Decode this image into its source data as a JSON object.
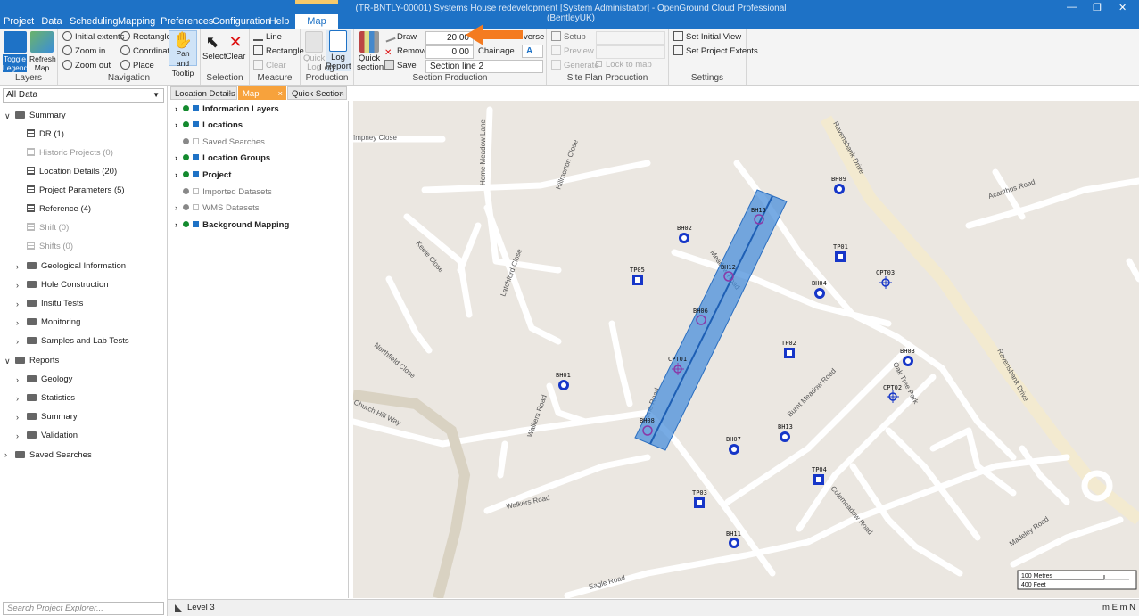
{
  "window": {
    "title": "(TR-BNTLY-00001) Systems House redevelopment [System Administrator] - OpenGround Cloud Professional (BentleyUK)",
    "minimize": "—",
    "restore": "❐",
    "close": "✕"
  },
  "menu": [
    {
      "label": "Project"
    },
    {
      "label": "Data"
    },
    {
      "label": "Scheduling"
    },
    {
      "label": "Mapping"
    },
    {
      "label": "Preferences"
    },
    {
      "label": "Configuration"
    },
    {
      "label": "Help"
    },
    {
      "label": "Map Tools"
    }
  ],
  "ribbon": {
    "layers": {
      "label": "Layers",
      "toggle_legend": "Toggle Legend",
      "refresh_map": "Refresh Map"
    },
    "navigation": {
      "label": "Navigation",
      "initial_extents": "Initial extents",
      "zoom_in": "Zoom in",
      "zoom_out": "Zoom out",
      "rectangle": "Rectangle",
      "coordinate": "Coordinate",
      "place": "Place",
      "pan_tooltip": "Pan and Tooltip"
    },
    "selection": {
      "label": "Selection",
      "select": "Select",
      "clear": "Clear"
    },
    "measure": {
      "label": "Measure",
      "line": "Line",
      "rectangle": "Rectangle",
      "clear": "Clear"
    },
    "log_production": {
      "label": "Log Production",
      "quick_log": "Quick Log",
      "log_report": "Log Report"
    },
    "section_production": {
      "label": "Section Production",
      "quick_section": "Quick section",
      "draw": "Draw",
      "remove": "Remove",
      "save": "Save",
      "width_value": "20.00",
      "offset_value": "0.00",
      "reverse": "verse",
      "chainage": "Chainage",
      "section_name": "Section line 2"
    },
    "site_plan": {
      "label": "Site Plan Production",
      "setup": "Setup",
      "preview": "Preview",
      "generate": "Generate",
      "lock": "Lock to map"
    },
    "settings": {
      "label": "Settings",
      "set_initial": "Set Initial View",
      "set_extents": "Set Project Extents"
    }
  },
  "explorer": {
    "filter": "All Data",
    "items": [
      {
        "label": "Summary"
      },
      {
        "label": "DR (1)"
      },
      {
        "label": "Historic Projects (0)"
      },
      {
        "label": "Location Details (20)"
      },
      {
        "label": "Project Parameters (5)"
      },
      {
        "label": "Reference (4)"
      },
      {
        "label": "Shift (0)"
      },
      {
        "label": "Shifts (0)"
      },
      {
        "label": "Geological Information"
      },
      {
        "label": "Hole Construction"
      },
      {
        "label": "Insitu Tests"
      },
      {
        "label": "Monitoring"
      },
      {
        "label": "Samples and Lab Tests"
      },
      {
        "label": "Reports"
      },
      {
        "label": "Geology"
      },
      {
        "label": "Statistics"
      },
      {
        "label": "Summary"
      },
      {
        "label": "Validation"
      },
      {
        "label": "Saved Searches"
      }
    ],
    "search_placeholder": "Search Project Explorer..."
  },
  "tabs": [
    {
      "label": "Location Details"
    },
    {
      "label": "Map"
    },
    {
      "label": "Quick Section"
    }
  ],
  "layers": [
    {
      "label": "Information Layers"
    },
    {
      "label": "Locations"
    },
    {
      "label": "Saved Searches"
    },
    {
      "label": "Location Groups"
    },
    {
      "label": "Project"
    },
    {
      "label": "Imported Datasets"
    },
    {
      "label": "WMS Datasets"
    },
    {
      "label": "Background Mapping"
    }
  ],
  "map": {
    "streets": [
      "Impney Close",
      "Home Meadow Lane",
      "Hillmorton Close",
      "Keele Close",
      "Latchford Close",
      "Northfield Close",
      "Church Hill Way",
      "Walkers Road",
      "Walkers Road",
      "Eagle Road",
      "Burnt Meadow Road",
      "Oak Tree Park",
      "Colemeadow Road",
      "Ravensbank Drive",
      "Ravensbank Drive",
      "Acanthus Road",
      "Madeley Road",
      "Meadow Road",
      "Lane Road"
    ],
    "points": [
      "BH15",
      "BH09",
      "BH02",
      "TP01",
      "TP05",
      "BH12",
      "CPT03",
      "BH04",
      "BH06",
      "TP02",
      "BH03",
      "CPT01",
      "BH01",
      "CPT02",
      "BH08",
      "BH13",
      "BH07",
      "TP04",
      "TP03",
      "BH11"
    ],
    "scale_m": "100 Metres",
    "scale_ft": "400 Feet"
  },
  "status": {
    "level": "Level 3",
    "units": "m E m N"
  },
  "colors": {
    "accent": "#1e72c6",
    "tab_active": "#f7a23c",
    "section": "#4a8fdb"
  }
}
